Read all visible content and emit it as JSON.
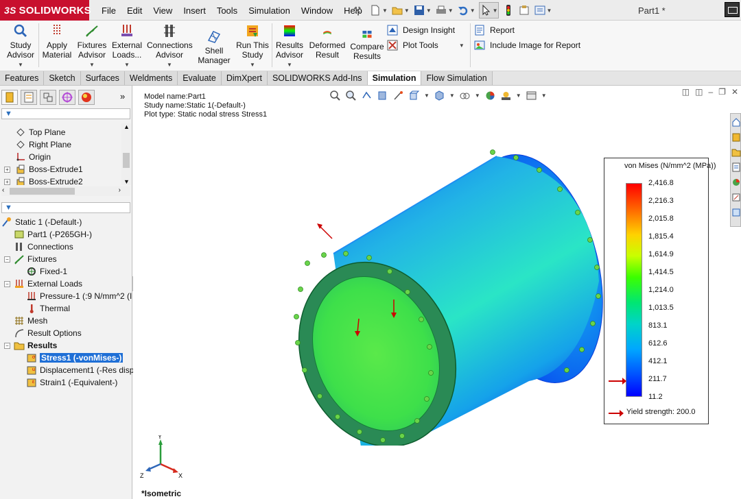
{
  "app": {
    "brand": "SOLIDWORKS",
    "brand_mark": "3S",
    "document_title": "Part1 *",
    "menu": [
      "File",
      "Edit",
      "View",
      "Insert",
      "Tools",
      "Simulation",
      "Window",
      "Help"
    ],
    "quick_access_icons": [
      "new-icon",
      "open-icon",
      "save-icon",
      "print-icon",
      "undo-icon",
      "select-icon",
      "traffic-light-icon",
      "options-icon",
      "customize-icon"
    ]
  },
  "ribbon": {
    "study_advisor": [
      "Study",
      "Advisor"
    ],
    "apply_material": [
      "Apply",
      "Material"
    ],
    "fixtures_advisor": [
      "Fixtures",
      "Advisor"
    ],
    "external_loads": [
      "External",
      "Loads..."
    ],
    "connections_advisor": [
      "Connections",
      "Advisor"
    ],
    "shell_manager": [
      "Shell",
      "Manager"
    ],
    "run_this_study": [
      "Run This",
      "Study"
    ],
    "results_advisor": [
      "Results",
      "Advisor"
    ],
    "deformed_result": [
      "Deformed",
      "Result"
    ],
    "compare_results": [
      "Compare",
      "Results"
    ],
    "design_insight": "Design Insight",
    "plot_tools": "Plot Tools",
    "report": "Report",
    "include_image": "Include Image for Report"
  },
  "tabs": [
    "Features",
    "Sketch",
    "Surfaces",
    "Weldments",
    "Evaluate",
    "DimXpert",
    "SOLIDWORKS Add-Ins",
    "Simulation",
    "Flow Simulation"
  ],
  "active_tab": "Simulation",
  "feature_tree": {
    "items": [
      "Top Plane",
      "Right Plane",
      "Origin",
      "Boss-Extrude1",
      "Boss-Extrude2"
    ]
  },
  "study_tree": {
    "study": "Static 1 (-Default-)",
    "part": "Part1 (-P265GH-)",
    "connections": "Connections",
    "fixtures": "Fixtures",
    "fixed": "Fixed-1",
    "external_loads": "External Loads",
    "pressure": "Pressure-1 (:9 N/mm^2 (I",
    "thermal": "Thermal",
    "mesh": "Mesh",
    "result_options": "Result Options",
    "results": "Results",
    "stress": "Stress1 (-vonMises-)",
    "displacement": "Displacement1 (-Res disp",
    "strain": "Strain1 (-Equivalent-)"
  },
  "viewport": {
    "model_name": "Model name:Part1",
    "study_name": "Study name:Static 1(-Default-)",
    "plot_type": "Plot type: Static nodal stress Stress1",
    "view_name": "*Isometric",
    "axis_x": "X",
    "axis_y": "Y",
    "axis_z": "Z"
  },
  "legend": {
    "title": "von Mises (N/mm^2 (MPa))",
    "values": [
      "2,416.8",
      "2,216.3",
      "2,015.8",
      "1,815.4",
      "1,614.9",
      "1,414.5",
      "1,214.0",
      "1,013.5",
      "813.1",
      "612.6",
      "412.1",
      "211.7",
      "11.2"
    ],
    "yield_label": "Yield strength: 200.0",
    "colors": {
      "max": "#ff0000",
      "mid": "#3cff00",
      "min": "#0000ff",
      "yield_arrow": "#cc0000"
    }
  }
}
